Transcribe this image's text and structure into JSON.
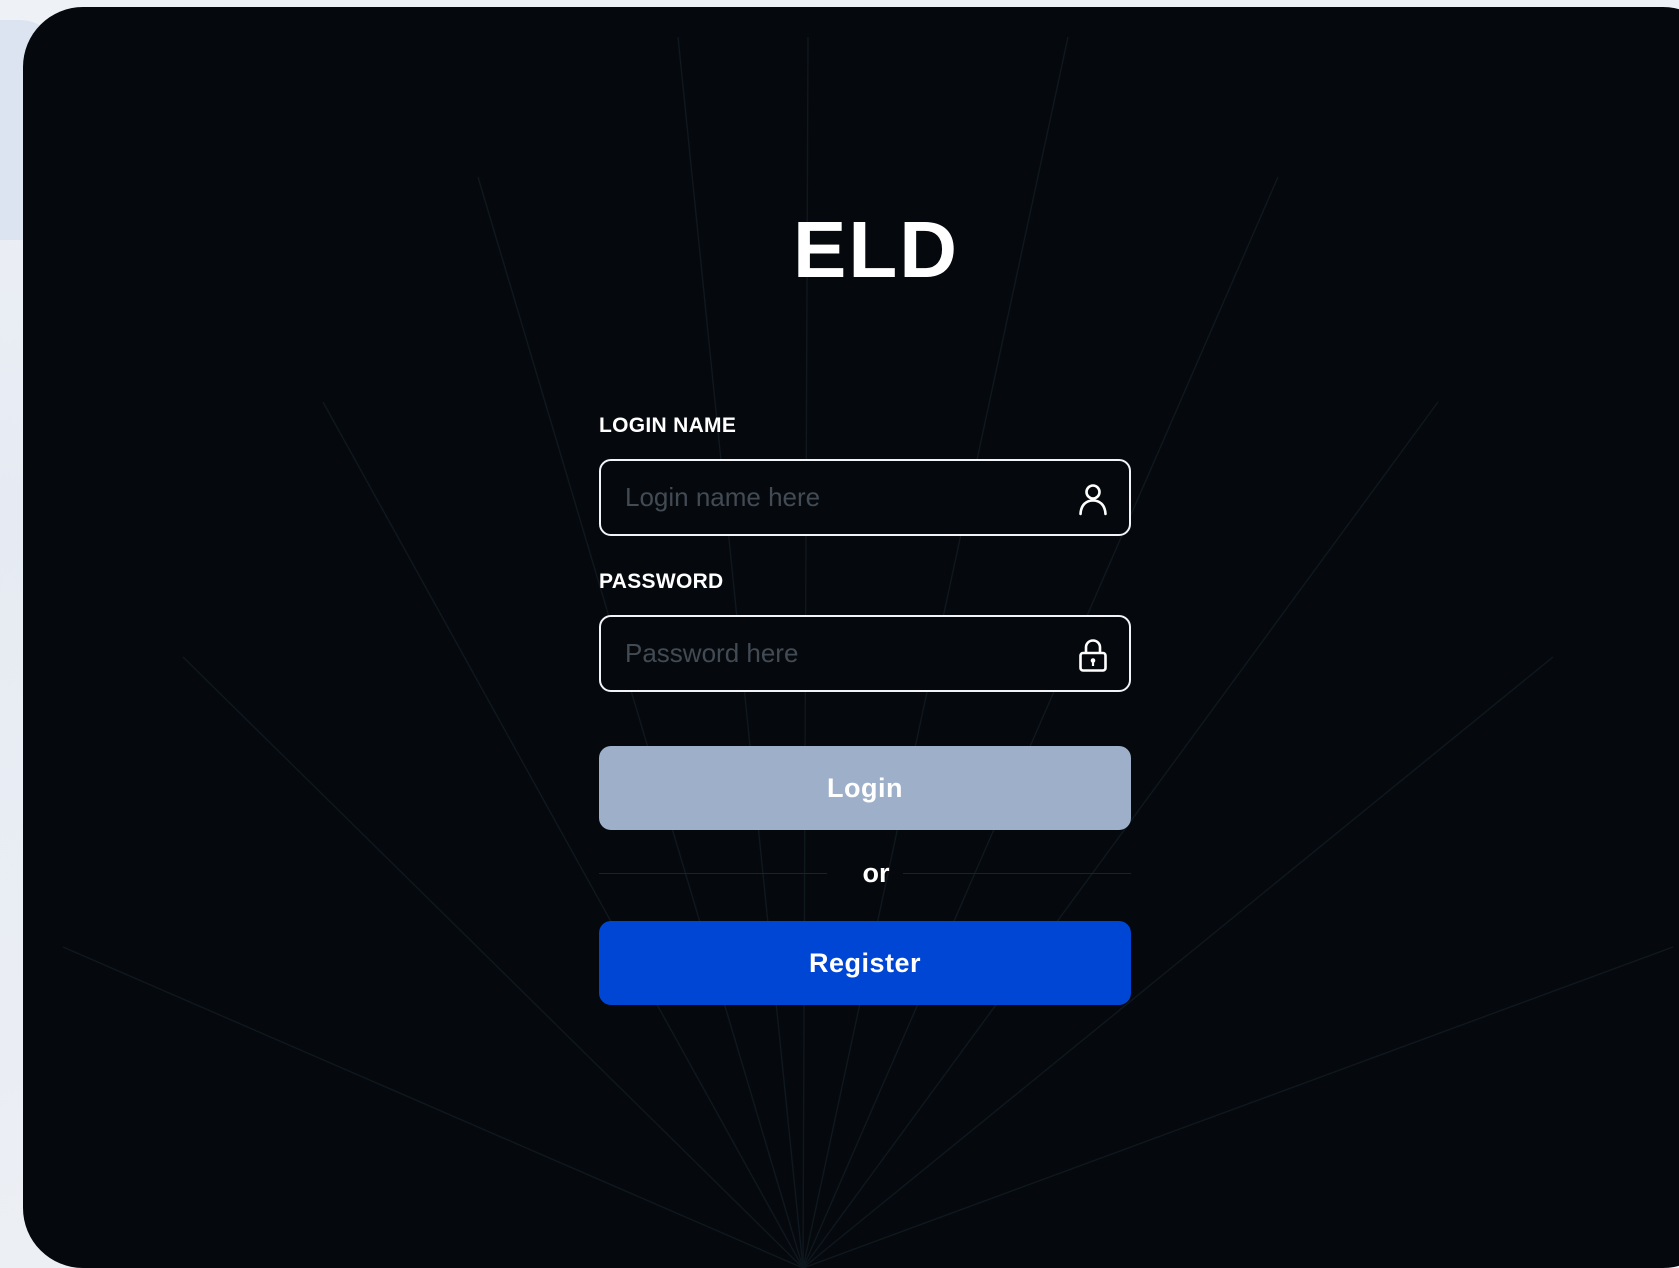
{
  "app": {
    "title": "ELD"
  },
  "form": {
    "login_name": {
      "label": "LOGIN NAME",
      "value": "",
      "placeholder": "Login name here",
      "icon": "user-icon"
    },
    "password": {
      "label": "PASSWORD",
      "value": "",
      "placeholder": "Password here",
      "icon": "lock-icon"
    },
    "login_button_label": "Login",
    "divider_text": "or",
    "register_button_label": "Register"
  },
  "colors": {
    "card_background": "#05090d",
    "login_button": "#9eafc9",
    "register_button": "#0046d5",
    "input_border": "#f2f4f7",
    "placeholder_text": "#424a54"
  }
}
